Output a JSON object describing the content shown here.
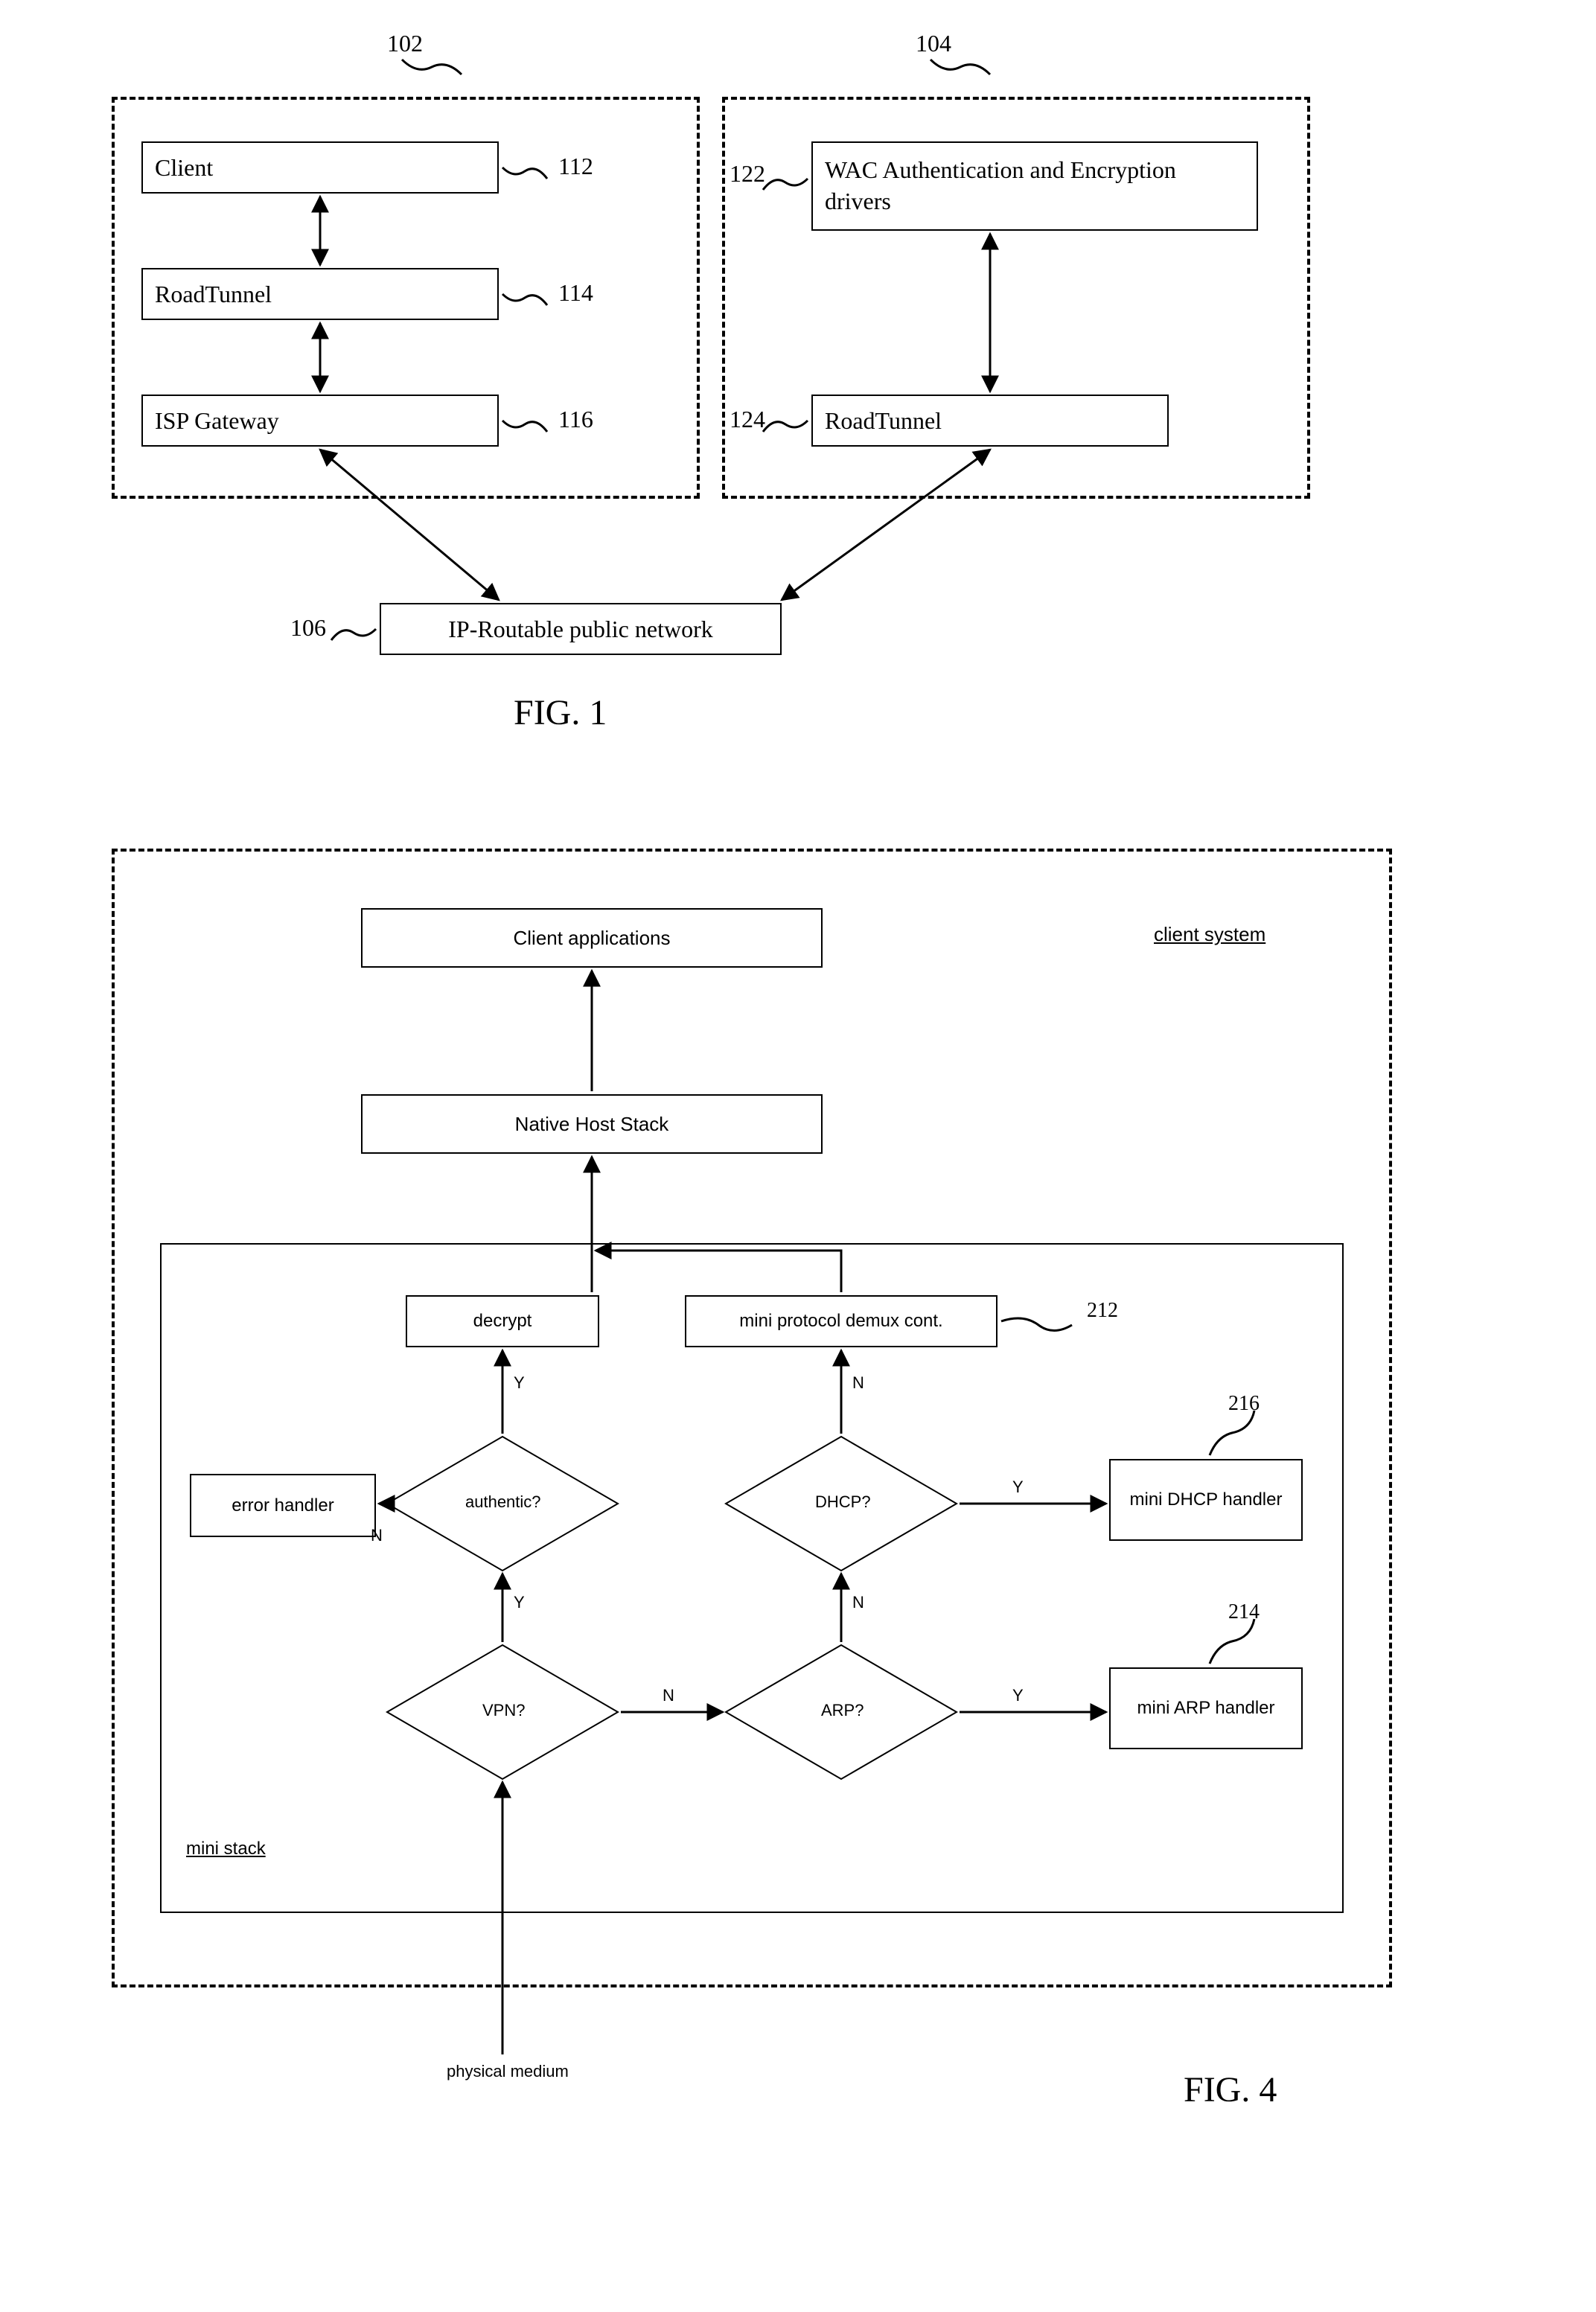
{
  "fig1": {
    "ref102": "102",
    "ref104": "104",
    "ref106": "106",
    "ref112": "112",
    "ref114": "114",
    "ref116": "116",
    "ref122": "122",
    "ref124": "124",
    "client": "Client",
    "roadtunnel_left": "RoadTunnel",
    "isp": "ISP Gateway",
    "wac": "WAC Authentication and Encryption drivers",
    "roadtunnel_right": "RoadTunnel",
    "ipnet": "IP-Routable public network",
    "caption": "FIG. 1"
  },
  "fig4": {
    "client_apps": "Client applications",
    "client_system": "client system",
    "native_host": "Native Host Stack",
    "decrypt": "decrypt",
    "demux": "mini protocol demux cont.",
    "error_handler": "error handler",
    "authentic": "authentic?",
    "dhcp": "DHCP?",
    "vpn": "VPN?",
    "arp": "ARP?",
    "mini_dhcp": "mini DHCP handler",
    "mini_arp": "mini ARP handler",
    "mini_stack": "mini stack",
    "physical_medium": "physical medium",
    "ref212": "212",
    "ref214": "214",
    "ref216": "216",
    "Y": "Y",
    "N": "N",
    "caption": "FIG. 4"
  }
}
